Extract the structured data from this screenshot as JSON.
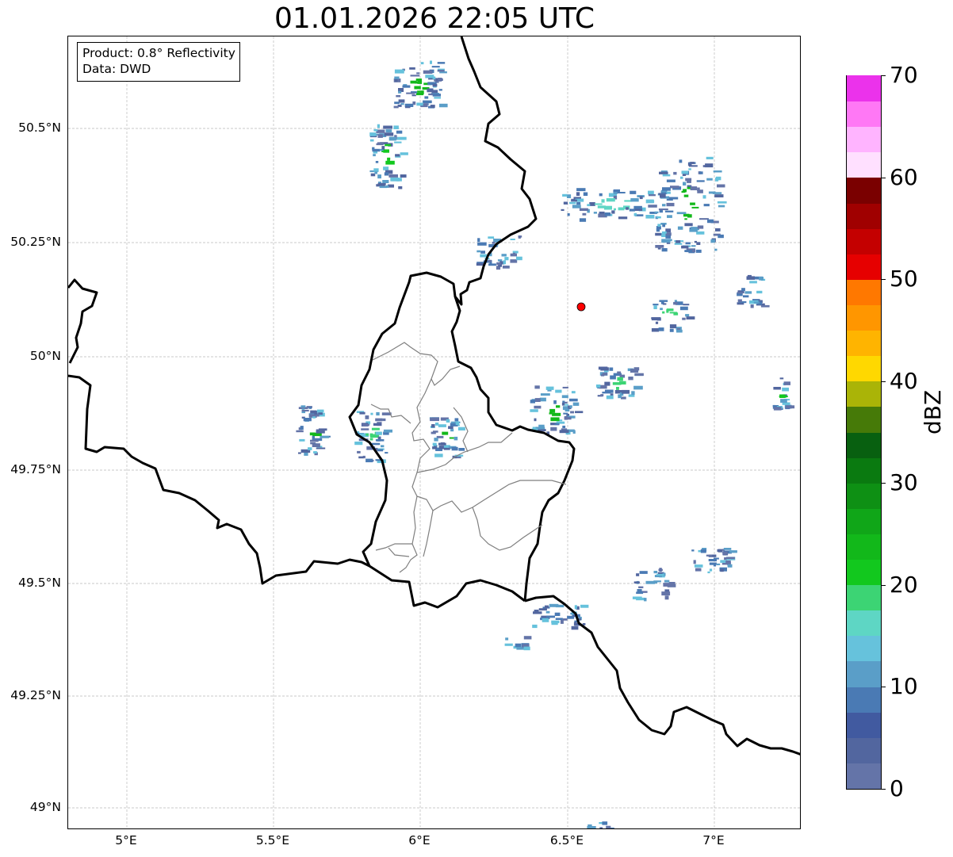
{
  "title": "01.01.2026 22:05 UTC",
  "info": {
    "product": "Product: 0.8° Reflectivity",
    "data": "Data: DWD"
  },
  "lat_ticks": [
    "50.5°N",
    "50.25°N",
    "50°N",
    "49.75°N",
    "49.5°N",
    "49.25°N",
    "49°N"
  ],
  "lon_ticks": [
    "5°E",
    "5.5°E",
    "6°E",
    "6.5°E",
    "7°E"
  ],
  "colorbar": {
    "label": "dBZ",
    "ticks": [
      "0",
      "10",
      "20",
      "30",
      "40",
      "50",
      "60",
      "70"
    ],
    "colors": [
      "#6474a8",
      "#52669f",
      "#415aa0",
      "#4a7ab4",
      "#5a9ec8",
      "#66c2dc",
      "#5ed6c4",
      "#3cd474",
      "#12c81e",
      "#12b81a",
      "#10a618",
      "#0e9014",
      "#0a7a10",
      "#086010",
      "#467a08",
      "#aab407",
      "#ffd800",
      "#ffb400",
      "#ff9600",
      "#ff7800",
      "#e60000",
      "#c40000",
      "#a00000",
      "#7a0000",
      "#ffe0ff",
      "#ffb4ff",
      "#ff78f5",
      "#eb32eb"
    ]
  },
  "radar_site_color": "#ff0000",
  "map_extent": {
    "lon_range": [
      4.8,
      7.3
    ],
    "lat_range": [
      48.95,
      50.7
    ]
  }
}
